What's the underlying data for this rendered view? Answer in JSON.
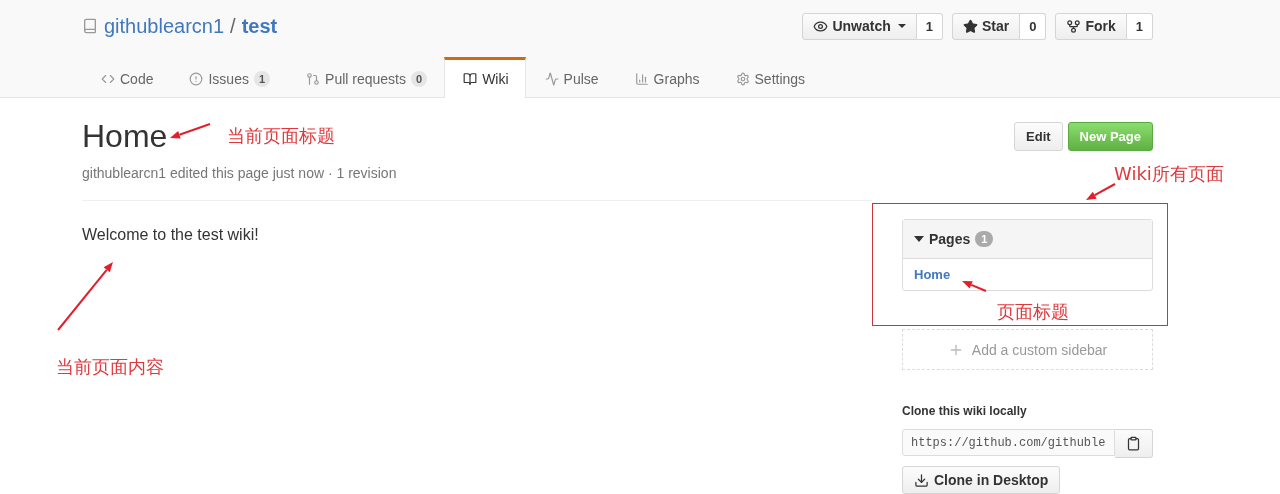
{
  "repo": {
    "owner": "githublearcn1",
    "separator": "/",
    "name": "test"
  },
  "actions": [
    {
      "kind": "watch",
      "label": "Unwatch",
      "count": "1",
      "dropdown": true
    },
    {
      "kind": "star",
      "label": "Star",
      "count": "0",
      "dropdown": false
    },
    {
      "kind": "fork",
      "label": "Fork",
      "count": "1",
      "dropdown": false
    }
  ],
  "tabs": [
    {
      "kind": "code",
      "label": "Code",
      "selected": false
    },
    {
      "kind": "issues",
      "label": "Issues",
      "count": "1",
      "selected": false
    },
    {
      "kind": "pulls",
      "label": "Pull requests",
      "count": "0",
      "selected": false
    },
    {
      "kind": "wiki",
      "label": "Wiki",
      "selected": true
    },
    {
      "kind": "pulse",
      "label": "Pulse",
      "selected": false
    },
    {
      "kind": "graphs",
      "label": "Graphs",
      "selected": false
    },
    {
      "kind": "settings",
      "label": "Settings",
      "selected": false
    }
  ],
  "page": {
    "title": "Home",
    "meta": "githublearcn1 edited this page just now · 1 revision",
    "body": "Welcome to the test wiki!"
  },
  "page_actions": [
    {
      "kind": "default",
      "label": "Edit"
    },
    {
      "kind": "primary",
      "label": "New Page"
    }
  ],
  "sidebar": {
    "pages_title": "Pages",
    "pages_count": "1",
    "expanded": true,
    "pages": [
      {
        "label": "Home"
      }
    ],
    "add_sidebar": "Add a custom sidebar",
    "clone_title": "Clone this wiki locally",
    "clone_url": "https://github.com/githuble",
    "clone_desktop": "Clone in Desktop"
  },
  "annotations": [
    {
      "kind": "title",
      "text": "当前页面标题"
    },
    {
      "kind": "sidebar",
      "text": "Wiki所有页面"
    },
    {
      "kind": "pagetitle",
      "text": "页面标题"
    },
    {
      "kind": "content",
      "text": "当前页面内容"
    }
  ]
}
